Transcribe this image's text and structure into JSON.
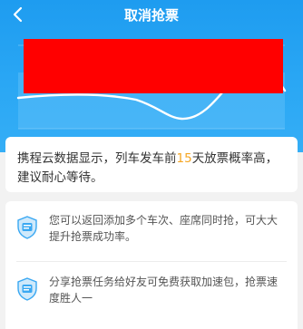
{
  "header": {
    "title": "取消抢票",
    "back_icon": "chevron-left-icon"
  },
  "hero": {
    "background_color": "#2aa7f4",
    "redaction_color": "#ff0000"
  },
  "info": {
    "text_prefix": "携程云数据显示，列车发车前",
    "highlight": "15",
    "text_suffix": "天放票概率高，建议耐心等待。",
    "highlight_color": "#f5a623"
  },
  "tips": [
    {
      "icon": "ticket-shield-icon",
      "text": "您可以返回添加多个车次、座席同时抢，可大大提升抢票成功率。"
    },
    {
      "icon": "ticket-shield-icon",
      "text": "分享抢票任务给好友可免费获取加速包，抢票速度胜人一"
    }
  ]
}
